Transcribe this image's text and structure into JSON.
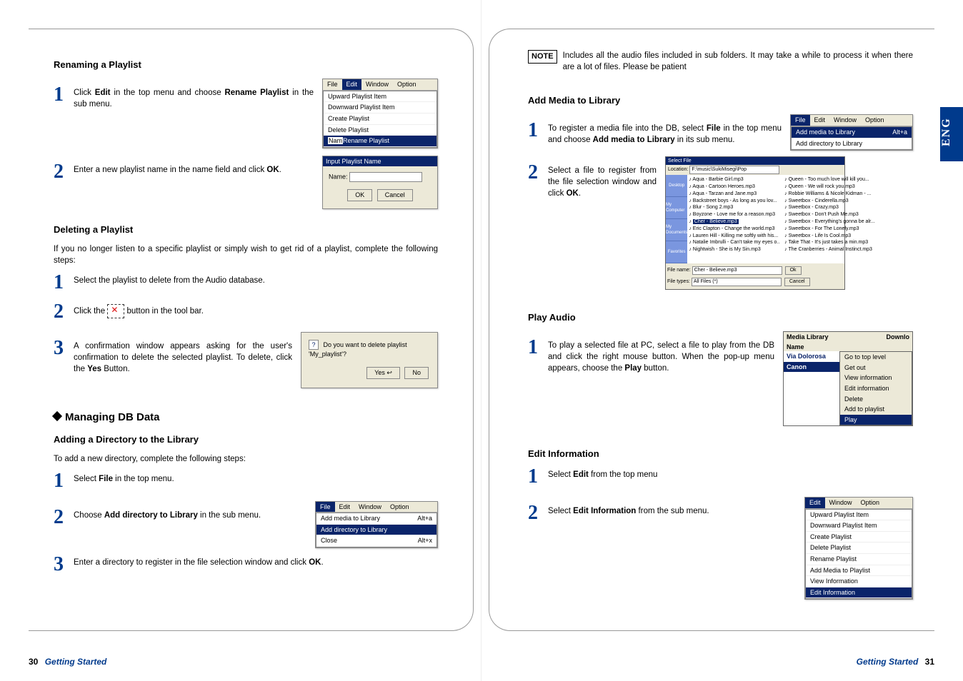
{
  "lang_tab": "ENG",
  "left": {
    "section1": {
      "title": "Renaming a Playlist",
      "step1_text": "Click Edit in the top menu and choose Rename Playlist in the sub menu.",
      "step1_html": "Click <b>Edit</b> in the top menu and choose <b>Rename Playlist</b> in the sub menu.",
      "menu_file": "File",
      "menu_edit": "Edit",
      "menu_window": "Window",
      "menu_option": "Option",
      "menu_items": {
        "up": "Upward Playlist Item",
        "down": "Downward Playlist Item",
        "create": "Create Playlist",
        "delete": "Delete Playlist",
        "rename": "Rename Playlist"
      },
      "menu_prefix": "Nam",
      "step2_text": "Enter a new playlist name in the name field and click OK.",
      "step2_html": "Enter a new playlist name in the name field and click <b>OK</b>.",
      "dlg_title": "Input Playlist Name",
      "dlg_label": "Name:",
      "dlg_ok": "OK",
      "dlg_cancel": "Cancel"
    },
    "section2": {
      "title": "Deleting a Playlist",
      "intro": "If you no longer listen to a specific playlist or simply wish to get rid of a playlist, complete the following steps:",
      "step1": "Select the playlist to delete from the Audio database.",
      "step2_a": "Click the",
      "step2_b": "button in the tool bar.",
      "step3": "A confirmation window appears asking for the user's confirmation to delete the selected playlist. To delete, click the Yes Button.",
      "step3_html": "A confirmation window appears asking for the user's confirmation to delete the selected playlist. To delete, click the <b>Yes</b> Button.",
      "confirm_q": "Do you want to delete playlist  'My_playlist'?",
      "confirm_yes": "Yes",
      "confirm_no": "No"
    },
    "section3": {
      "heading": "Managing DB Data",
      "subtitle": "Adding a Directory to the Library",
      "intro": "To add a new directory, complete the following steps:",
      "step1_html": "Select <b>File</b> in the top menu.",
      "step2_html": "Choose <b>Add directory to Library</b> in the sub menu.",
      "menu_file": "File",
      "menu_edit": "Edit",
      "menu_window": "Window",
      "menu_option": "Option",
      "menu_add_media": "Add media to Library",
      "menu_add_media_sc": "Alt+a",
      "menu_add_dir": "Add directory to Library",
      "menu_close": "Close",
      "menu_close_sc": "Alt+x",
      "step3_html": "Enter a directory to register in the file selection window and click <b>OK</b>."
    },
    "footer_page": "30",
    "footer_section": "Getting Started"
  },
  "right": {
    "note_tag": "NOTE",
    "note_text": "Includes all the audio files included in sub folders. It may take a while to process it when there are a lot of files. Please be patient",
    "section1": {
      "title": "Add Media to Library",
      "step1_html": "To register a media file into the DB, select <b>File</b> in the top menu and choose <b>Add media to Library</b> in its sub menu.",
      "menu_file": "File",
      "menu_edit": "Edit",
      "menu_window": "Window",
      "menu_option": "Option",
      "menu_add_media": "Add media to Library",
      "menu_add_media_sc": "Alt+a",
      "menu_add_dir": "Add directory to Library",
      "step2_html": "Select a file to register from the file selection window and click <b>OK</b>.",
      "fb": {
        "title": "Select File",
        "location_label": "Location:",
        "location_value": "F:\\music\\SukiMisegi\\Pop",
        "side": [
          "Desktop",
          "My Computer",
          "My Documents",
          "Favorites"
        ],
        "files_left": [
          "Aqua - Barbie Girl.mp3",
          "Aqua - Cartoon Heroes.mp3",
          "Aqua - Tarzan and Jane.mp3",
          "Backstreet boys - As long as you lov...",
          "Blur - Song 2.mp3",
          "Boyzone - Love me for a reason.mp3",
          "Cher - Believe.mp3",
          "Eric Clapton - Change the world.mp3",
          "Lauren Hill - Killing me softly with his...",
          "Natalie Imbrulli - Can't take my eyes o...",
          "Nightwish - She is My Sin.mp3"
        ],
        "selected_index": 6,
        "files_right": [
          "Queen - Too much love will kill you...",
          "Queen - We will rock you.mp3",
          "Robbie Williams & Nicole Kidman - ...",
          "Sweetbox - Cinderella.mp3",
          "Sweetbox - Crazy.mp3",
          "Sweetbox - Don't Push Me.mp3",
          "Sweetbox - Everything's gonna be alr...",
          "Sweetbox - For The Lonely.mp3",
          "Sweetbox - Life Is Cool.mp3",
          "Take That - It's just takes a min.mp3",
          "The Cranberries - Animal Instinct.mp3"
        ],
        "filename_label": "File name:",
        "filename_value": "Cher - Believe.mp3",
        "filetype_label": "File types:",
        "filetype_value": "All Files (*)",
        "ok": "Ok",
        "cancel": "Cancel"
      }
    },
    "section2": {
      "title": "Play Audio",
      "step1_html": "To play a selected file at PC, select a file to play from the DB and click the right mouse button. When the pop-up menu appears, choose the <b>Play</b> button.",
      "media_hdr_left": "Media Library",
      "media_hdr_right": "Downlo",
      "col_name": "Name",
      "list": [
        "Via Dolorosa",
        "Canon"
      ],
      "ctx": [
        "Go to top level",
        "Get out",
        "View information",
        "Edit information",
        "Delete",
        "Add to playlist",
        "Play"
      ]
    },
    "section3": {
      "title": "Edit Information",
      "step1_html": "Select <b>Edit</b> from the top menu",
      "step2_html": "Select <b>Edit Information</b> from the sub menu.",
      "menu_edit": "Edit",
      "menu_window": "Window",
      "menu_option": "Option",
      "items": [
        "Upward Playlist Item",
        "Downward Playlist Item",
        "Create Playlist",
        "Delete Playlist",
        "Rename Playlist",
        "Add Media to Playlist",
        "View Information",
        "Edit Information"
      ]
    },
    "footer_section": "Getting Started",
    "footer_page": "31"
  }
}
